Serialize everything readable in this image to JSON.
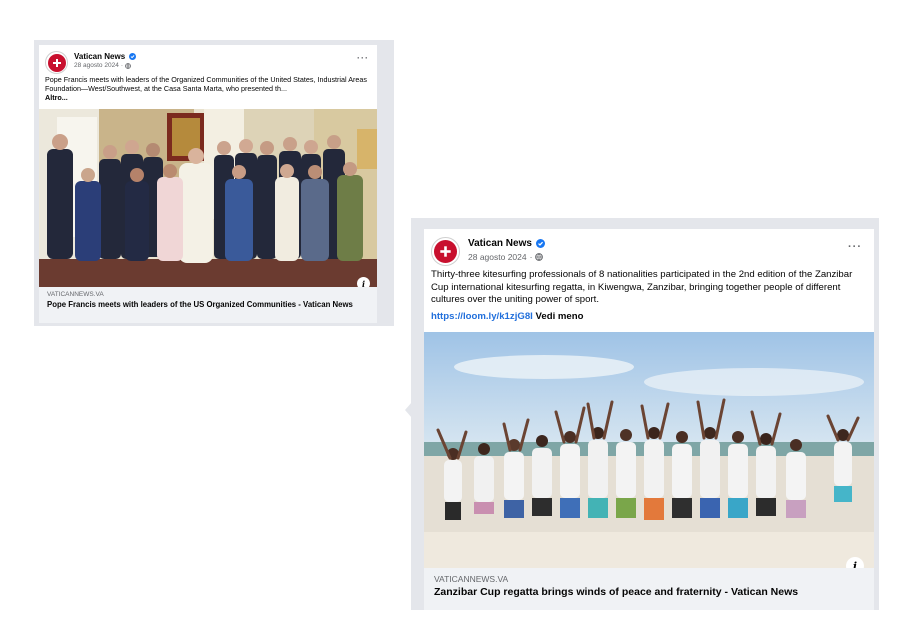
{
  "posts": [
    {
      "page_name": "Vatican News",
      "date": "28 agosto 2024",
      "privacy_icon": "globe-icon",
      "text": "Pope Francis meets with leaders of the Organized Communities of the United States, Industrial Areas Foundation—West/Southwest, at the Casa Santa Marta, who presented th...",
      "see_more": "Altro...",
      "link_domain": "VATICANNEWS.VA",
      "link_title": "Pope Francis meets with leaders of the US Organized Communities - Vatican News",
      "more_label": "···"
    },
    {
      "page_name": "Vatican News",
      "date": "28 agosto 2024",
      "privacy_icon": "globe-icon",
      "text": "Thirty-three kitesurfing professionals of 8 nationalities participated in the 2nd edition of the Zanzibar Cup international kitesurfing regatta, in Kiwengwa, Zanzibar, bringing together people of different cultures over the uniting power of sport.",
      "url": "https://loom.ly/k1zjG8I",
      "see_more": "Vedi meno",
      "link_domain": "VATICANNEWS.VA",
      "link_title": "Zanzibar Cup regatta brings winds of peace and fraternity - Vatican News",
      "more_label": "···"
    }
  ],
  "info_glyph": "i",
  "colors": {
    "verified": "#1877f2",
    "link_bar": "#f0f2f5",
    "brand_red": "#c8102e"
  }
}
